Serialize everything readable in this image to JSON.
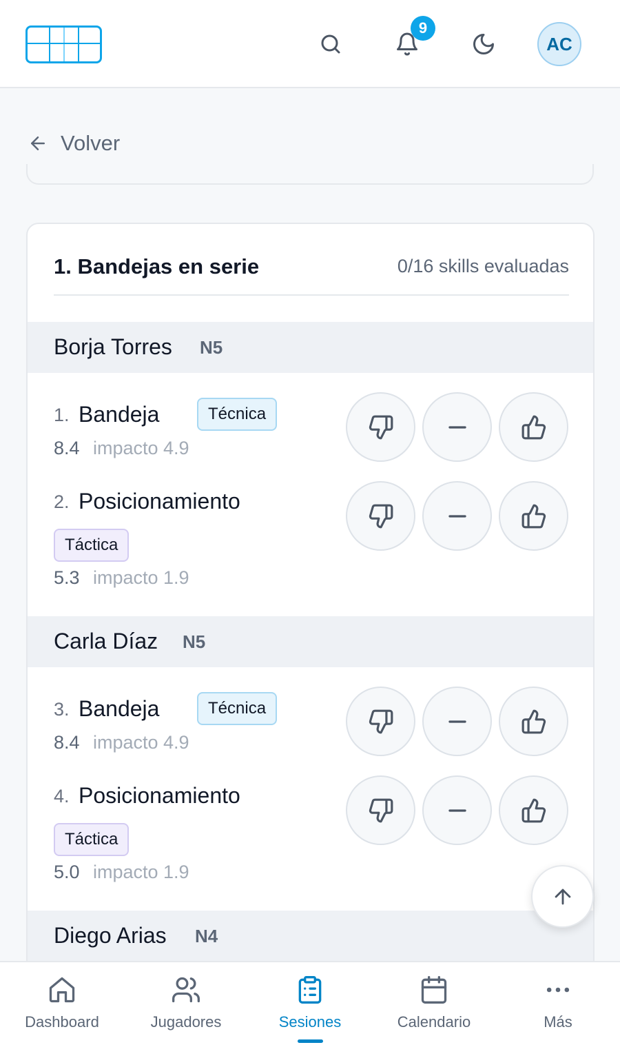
{
  "header": {
    "notifications_count": "9",
    "avatar_initials": "AC",
    "icons": [
      "search-icon",
      "bell-icon",
      "moon-icon"
    ]
  },
  "back": {
    "label": "Volver"
  },
  "session": {
    "title": "1. Bandejas en serie",
    "progress": "0/16 skills evaluadas"
  },
  "players": [
    {
      "name": "Borja Torres",
      "level": "N5",
      "skills": [
        {
          "num": "1.",
          "name": "Bandeja",
          "tag": "Técnica",
          "score": "8.4",
          "impact": "impacto 4.9"
        },
        {
          "num": "2.",
          "name": "Posicionamiento",
          "tag": "Táctica",
          "score": "5.3",
          "impact": "impacto 1.9"
        }
      ]
    },
    {
      "name": "Carla Díaz",
      "level": "N5",
      "skills": [
        {
          "num": "3.",
          "name": "Bandeja",
          "tag": "Técnica",
          "score": "8.4",
          "impact": "impacto 4.9"
        },
        {
          "num": "4.",
          "name": "Posicionamiento",
          "tag": "Táctica",
          "score": "5.0",
          "impact": "impacto 1.9"
        }
      ]
    },
    {
      "name": "Diego Arias",
      "level": "N4",
      "skills": []
    }
  ],
  "nav": {
    "items": [
      {
        "label": "Dashboard",
        "icon": "home-icon"
      },
      {
        "label": "Jugadores",
        "icon": "users-icon"
      },
      {
        "label": "Sesiones",
        "icon": "clipboard-list-icon",
        "active": true
      },
      {
        "label": "Calendario",
        "icon": "calendar-icon"
      },
      {
        "label": "Más",
        "icon": "more-dots-icon"
      }
    ]
  },
  "colors": {
    "accent": "#0ea5e9",
    "active_nav": "#0284c7",
    "tag_tecnica_bg": "#e6f4fc",
    "tag_tactica_bg": "#f1eefc"
  }
}
